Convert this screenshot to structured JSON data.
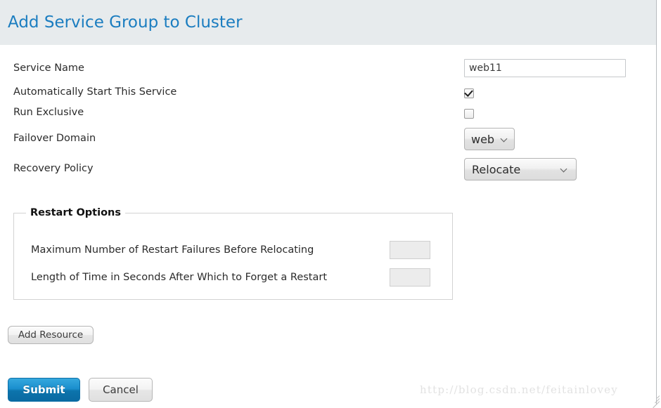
{
  "dialog": {
    "title": "Add Service Group to Cluster",
    "title_color": "#1b7dc0",
    "header_bg": "#e7ebed"
  },
  "form": {
    "rows": [
      {
        "label": "Service Name",
        "control": "text",
        "value": "web11",
        "placeholder": ""
      },
      {
        "label": "Automatically Start This Service",
        "control": "checkbox",
        "checked": "true"
      },
      {
        "label": "Run Exclusive",
        "control": "checkbox",
        "checked": "false"
      },
      {
        "label": "Failover Domain",
        "control": "select",
        "value": "web"
      },
      {
        "label": "Recovery Policy",
        "control": "select",
        "value": "Relocate"
      }
    ]
  },
  "restart_options": {
    "legend": "Restart Options",
    "rows": [
      {
        "label": "Maximum Number of Restart Failures Before Relocating",
        "value": ""
      },
      {
        "label": "Length of Time in Seconds After Which to Forget a Restart",
        "value": ""
      }
    ]
  },
  "buttons": {
    "add_resource": "Add Resource",
    "submit": "Submit",
    "cancel": "Cancel",
    "submit_color": "#1b8fce"
  },
  "watermark": {
    "text": "http://blog.csdn.net/feitainlovey"
  },
  "icons": {
    "chevron_down": "chevron-down-icon",
    "check": "check-icon",
    "resize_grip": "resize-grip-icon"
  }
}
